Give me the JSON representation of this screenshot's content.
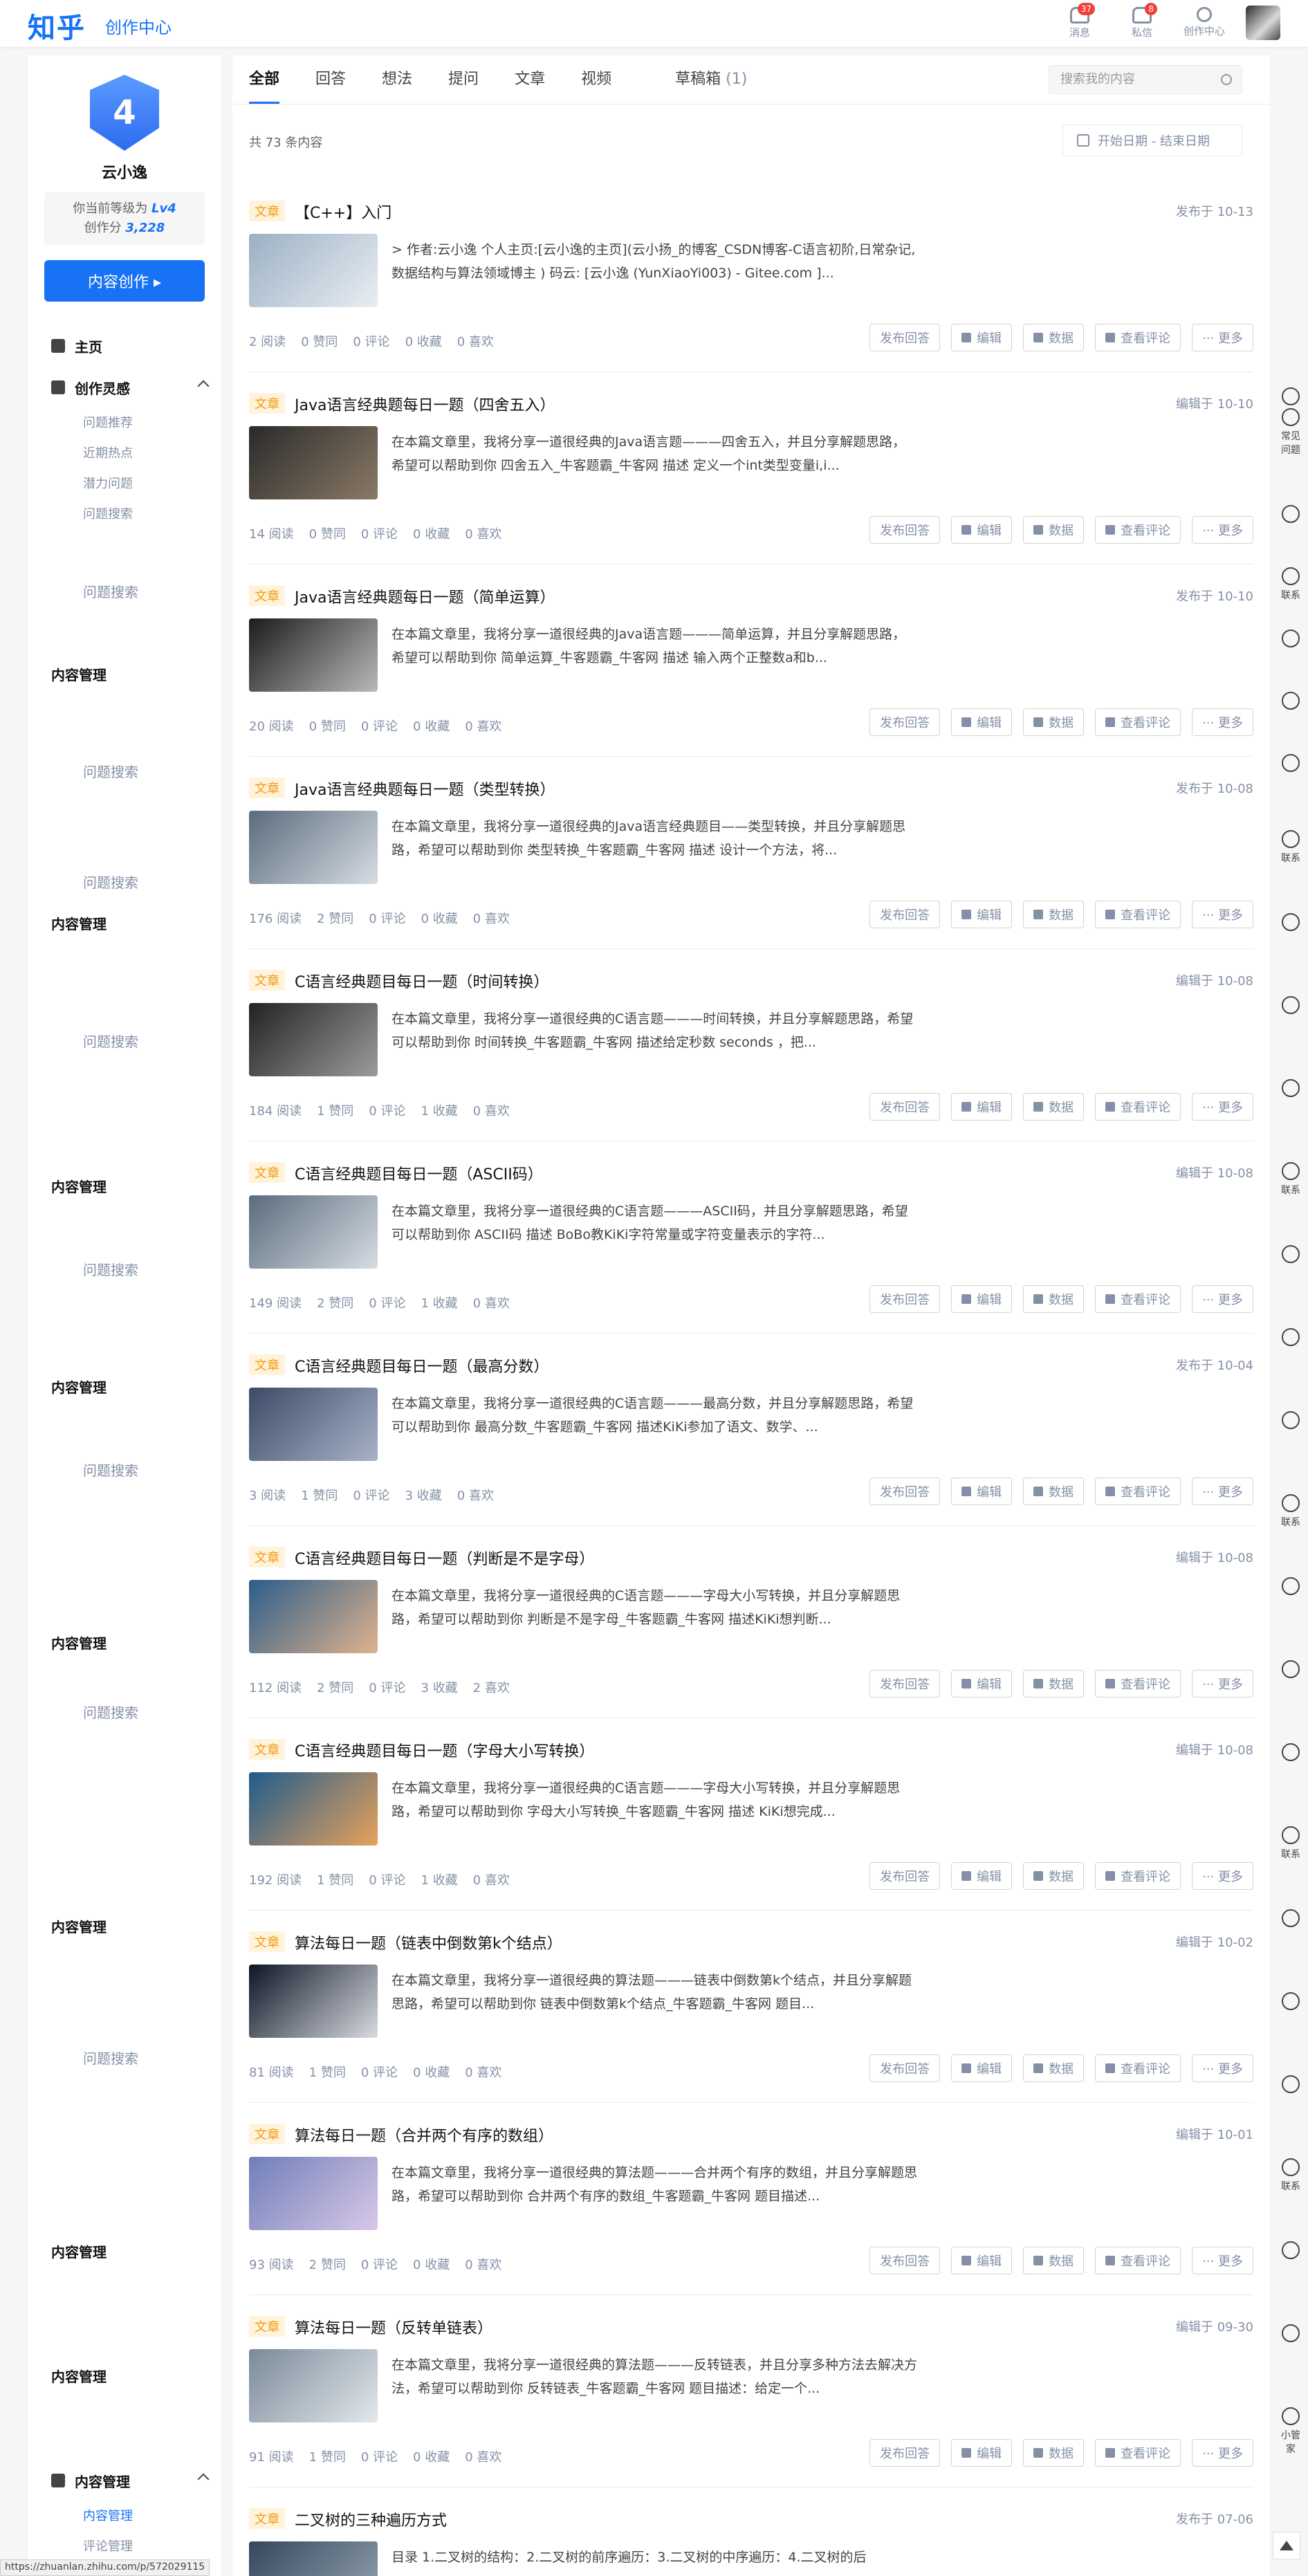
{
  "header": {
    "logo": "知乎",
    "logo_sub": "创作中心",
    "nav": [
      {
        "label": "消息",
        "badge": "37",
        "icon": "bell-icon"
      },
      {
        "label": "私信",
        "badge": "8",
        "icon": "chat-icon"
      },
      {
        "label": "创作中心",
        "badge": "",
        "icon": "user-icon"
      }
    ]
  },
  "sidebar": {
    "level_number": "4",
    "username": "云小逸",
    "level_text": "你当前等级为",
    "level_value": "Lv4",
    "score_text": "创作分",
    "score_value": "3,228",
    "create_button": "内容创作 ▸",
    "menu": [
      {
        "label": "主页",
        "icon": "home-icon",
        "expandable": false
      },
      {
        "label": "创作灵感",
        "icon": "pen-icon",
        "expandable": true
      }
    ],
    "inspiration_sub": [
      "问题推荐",
      "近期热点",
      "潜力问题",
      "问题搜索"
    ],
    "ghost_labels": {
      "search": "问题搜索",
      "manage": "内容管理"
    },
    "bottom_menu": {
      "label": "内容管理",
      "sub": [
        "内容管理",
        "评论管理"
      ]
    }
  },
  "tabs": [
    {
      "label": "全部",
      "active": true
    },
    {
      "label": "回答",
      "active": false
    },
    {
      "label": "想法",
      "active": false
    },
    {
      "label": "提问",
      "active": false
    },
    {
      "label": "文章",
      "active": false
    },
    {
      "label": "视频",
      "active": false
    }
  ],
  "drafts": {
    "label": "草稿箱",
    "count": "(1)"
  },
  "search_placeholder": "搜索我的内容",
  "total": "共 73 条内容",
  "date_range": "开始日期  -  结束日期",
  "actions": [
    "发布回答",
    "编辑",
    "数据",
    "查看评论",
    "··· 更多"
  ],
  "items": [
    {
      "tag": "文章",
      "title": "【C++】入门",
      "date": "发布于 10-13",
      "excerpt": "> 作者:云小逸 个人主页:[云小逸的主页](云小扬_的博客_CSDN博客-C语言初阶,日常杂记,数据结构与算法领域博主 ) 码云: [云小逸 (YunXiaoYi003) - Gitee.com ]...",
      "stats": [
        "2 阅读",
        "0 赞同",
        "0 评论",
        "0 收藏",
        "0 喜欢"
      ],
      "thumb": [
        "#9bb0c4",
        "#e9eef2"
      ]
    },
    {
      "tag": "文章",
      "title": "Java语言经典题每日一题（四舍五入）",
      "date": "编辑于 10-10",
      "excerpt": "在本篇文章里，我将分享一道很经典的Java语言题———四舍五入，并且分享解题思路，希望可以帮助到你 四舍五入_牛客题霸_牛客网 描述 定义一个int类型变量i,i...",
      "stats": [
        "14 阅读",
        "0 赞同",
        "0 评论",
        "0 收藏",
        "0 喜欢"
      ],
      "thumb": [
        "#2a2a2a",
        "#8a7a66"
      ]
    },
    {
      "tag": "文章",
      "title": "Java语言经典题每日一题（简单运算）",
      "date": "发布于 10-10",
      "excerpt": "在本篇文章里，我将分享一道很经典的Java语言题———简单运算，并且分享解题思路，希望可以帮助到你 简单运算_牛客题霸_牛客网 描述 输入两个正整数a和b...",
      "stats": [
        "20 阅读",
        "0 赞同",
        "0 评论",
        "0 收藏",
        "0 喜欢"
      ],
      "thumb": [
        "#1c1c1c",
        "#b9b9b9"
      ]
    },
    {
      "tag": "文章",
      "title": "Java语言经典题每日一题（类型转换）",
      "date": "发布于 10-08",
      "excerpt": "在本篇文章里，我将分享一道很经典的Java语言经典题目——类型转换，并且分享解题思路，希望可以帮助到你 类型转换_牛客题霸_牛客网 描述 设计一个方法，将...",
      "stats": [
        "176 阅读",
        "2 赞同",
        "0 评论",
        "0 收藏",
        "0 喜欢"
      ],
      "thumb": [
        "#5b6b7c",
        "#d6dde4"
      ]
    },
    {
      "tag": "文章",
      "title": "C语言经典题目每日一题（时间转换）",
      "date": "编辑于 10-08",
      "excerpt": "在本篇文章里，我将分享一道很经典的C语言题———时间转换，并且分享解题思路，希望可以帮助到你 时间转换_牛客题霸_牛客网 描述给定秒数 seconds ，把...",
      "stats": [
        "184 阅读",
        "1 赞同",
        "0 评论",
        "1 收藏",
        "0 喜欢"
      ],
      "thumb": [
        "#222222",
        "#9c9c9c"
      ]
    },
    {
      "tag": "文章",
      "title": "C语言经典题目每日一题（ASCII码）",
      "date": "编辑于 10-08",
      "excerpt": "在本篇文章里，我将分享一道很经典的C语言题———ASCII码，并且分享解题思路，希望可以帮助到你 ASCII码 描述 BoBo教KiKi字符常量或字符变量表示的字符...",
      "stats": [
        "149 阅读",
        "2 赞同",
        "0 评论",
        "1 收藏",
        "0 喜欢"
      ],
      "thumb": [
        "#5b6b7c",
        "#d6dde4"
      ]
    },
    {
      "tag": "文章",
      "title": "C语言经典题目每日一题（最高分数）",
      "date": "发布于 10-04",
      "excerpt": "在本篇文章里，我将分享一道很经典的C语言题———最高分数，并且分享解题思路，希望可以帮助到你 最高分数_牛客题霸_牛客网 描述KiKi参加了语文、数学、...",
      "stats": [
        "3 阅读",
        "1 赞同",
        "0 评论",
        "3 收藏",
        "0 喜欢"
      ],
      "thumb": [
        "#3c4a66",
        "#a8b3c8"
      ]
    },
    {
      "tag": "文章",
      "title": "C语言经典题目每日一题（判断是不是字母）",
      "date": "编辑于 10-08",
      "excerpt": "在本篇文章里，我将分享一道很经典的C语言题———字母大小写转换，并且分享解题思路，希望可以帮助到你 判断是不是字母_牛客题霸_牛客网 描述KiKi想判断...",
      "stats": [
        "112 阅读",
        "2 赞同",
        "0 评论",
        "3 收藏",
        "2 喜欢"
      ],
      "thumb": [
        "#2b5d8a",
        "#e0b28c"
      ]
    },
    {
      "tag": "文章",
      "title": "C语言经典题目每日一题（字母大小写转换）",
      "date": "编辑于 10-08",
      "excerpt": "在本篇文章里，我将分享一道很经典的C语言题———字母大小写转换，并且分享解题思路，希望可以帮助到你 字母大小写转换_牛客题霸_牛客网 描述 KiKi想完成...",
      "stats": [
        "192 阅读",
        "1 赞同",
        "0 评论",
        "1 收藏",
        "0 喜欢"
      ],
      "thumb": [
        "#1f5b8c",
        "#e8a25a"
      ]
    },
    {
      "tag": "文章",
      "title": "算法每日一题（链表中倒数第k个结点）",
      "date": "编辑于 10-02",
      "excerpt": "在本篇文章里，我将分享一道很经典的算法题———链表中倒数第k个结点，并且分享解题思路，希望可以帮助到你 链表中倒数第k个结点_牛客题霸_牛客网 题目...",
      "stats": [
        "81 阅读",
        "1 赞同",
        "0 评论",
        "0 收藏",
        "0 喜欢"
      ],
      "thumb": [
        "#0d1524",
        "#d8dbe2"
      ]
    },
    {
      "tag": "文章",
      "title": "算法每日一题（合并两个有序的数组）",
      "date": "编辑于 10-01",
      "excerpt": "在本篇文章里，我将分享一道很经典的算法题———合并两个有序的数组，并且分享解题思路，希望可以帮助到你 合并两个有序的数组_牛客题霸_牛客网 题目描述...",
      "stats": [
        "93 阅读",
        "2 赞同",
        "0 评论",
        "0 收藏",
        "0 喜欢"
      ],
      "thumb": [
        "#6f7fb8",
        "#d9c8e8"
      ]
    },
    {
      "tag": "文章",
      "title": "算法每日一题（反转单链表）",
      "date": "编辑于 09-30",
      "excerpt": "在本篇文章里，我将分享一道很经典的算法题———反转链表，并且分享多种方法去解决方法，希望可以帮助到你 反转链表_牛客题霸_牛客网 题目描述：给定一个...",
      "stats": [
        "91 阅读",
        "1 赞同",
        "0 评论",
        "0 收藏",
        "0 喜欢"
      ],
      "thumb": [
        "#7a8a99",
        "#e3e8ec"
      ]
    },
    {
      "tag": "文章",
      "title": "二叉树的三种遍历方式",
      "date": "发布于 07-06",
      "excerpt": "目录 1.二叉树的结构：2.二叉树的前序遍历：3.二叉树的中序遍历：4.二叉树的后",
      "stats": [],
      "thumb": [
        "#33475c",
        "#9aa8b5"
      ]
    }
  ],
  "rail": {
    "help_label": "常见问题",
    "contact_label": "联系",
    "butler_label": "小管家"
  },
  "status_url": "https://zhuanlan.zhihu.com/p/572029115",
  "colors": {
    "brand": "#1772f6",
    "tag_bg": "#fff3dc",
    "tag_fg": "#f39c12",
    "badge": "#f1403c"
  }
}
